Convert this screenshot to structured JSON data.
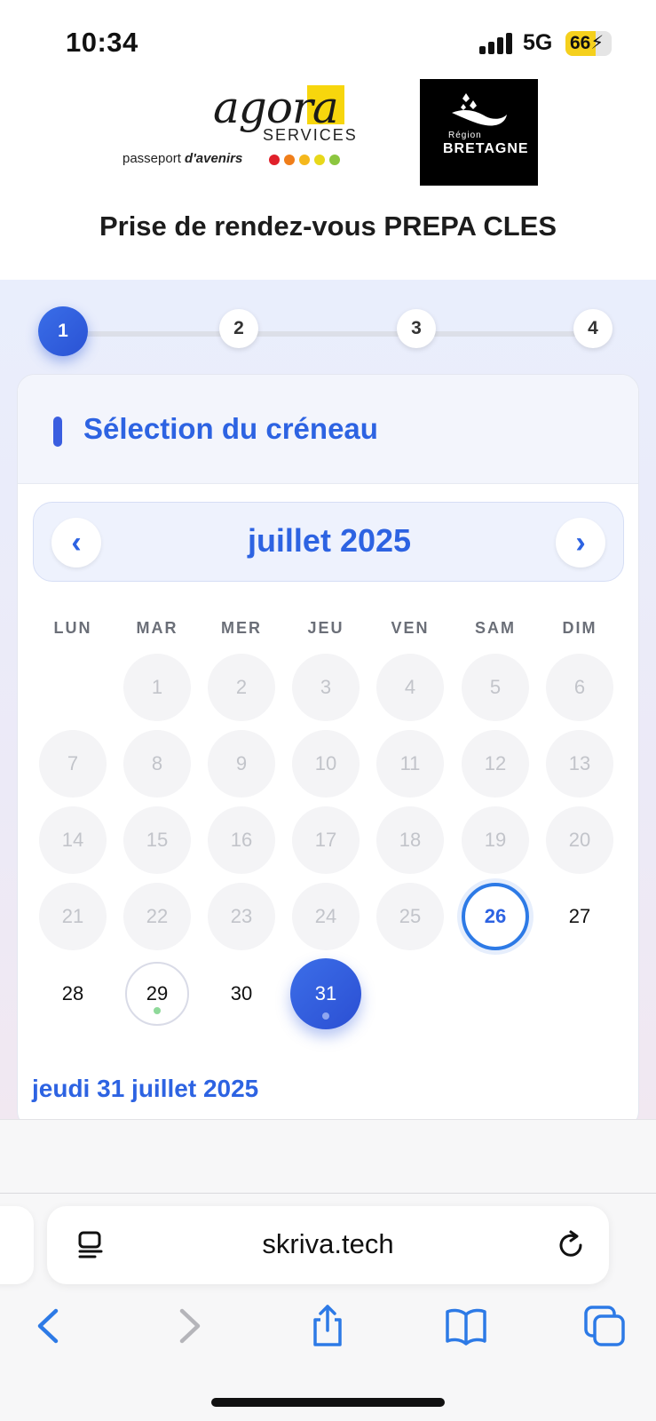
{
  "status_bar": {
    "time": "10:34",
    "network": "5G",
    "battery": "66",
    "battery_level": 0.66
  },
  "header": {
    "agora_logo": {
      "word": "agora",
      "services": "SERVICES",
      "tagline_prefix": "passeport ",
      "tagline_emphasis": "d'avenirs",
      "dot_colors": [
        "#e0202a",
        "#f07e1a",
        "#f5b81c",
        "#e8d81a",
        "#8cc63f"
      ]
    },
    "region_logo": {
      "region": "Région",
      "name": "BRETAGNE"
    },
    "page_title": "Prise de rendez-vous PREPA CLES"
  },
  "stepper": {
    "steps": [
      "1",
      "2",
      "3",
      "4"
    ],
    "active_step": 1
  },
  "card": {
    "title": "Sélection du créneau",
    "month_label": "juillet 2025",
    "prev_label": "‹",
    "next_label": "›",
    "weekdays": [
      "LUN",
      "MAR",
      "MER",
      "JEU",
      "VEN",
      "SAM",
      "DIM"
    ],
    "days": [
      {
        "n": "1",
        "state": "disabled"
      },
      {
        "n": "2",
        "state": "disabled"
      },
      {
        "n": "3",
        "state": "disabled"
      },
      {
        "n": "4",
        "state": "disabled"
      },
      {
        "n": "5",
        "state": "disabled"
      },
      {
        "n": "6",
        "state": "disabled"
      },
      {
        "n": "7",
        "state": "disabled"
      },
      {
        "n": "8",
        "state": "disabled"
      },
      {
        "n": "9",
        "state": "disabled"
      },
      {
        "n": "10",
        "state": "disabled"
      },
      {
        "n": "11",
        "state": "disabled"
      },
      {
        "n": "12",
        "state": "disabled"
      },
      {
        "n": "13",
        "state": "disabled"
      },
      {
        "n": "14",
        "state": "disabled"
      },
      {
        "n": "15",
        "state": "disabled"
      },
      {
        "n": "16",
        "state": "disabled"
      },
      {
        "n": "17",
        "state": "disabled"
      },
      {
        "n": "18",
        "state": "disabled"
      },
      {
        "n": "19",
        "state": "disabled"
      },
      {
        "n": "20",
        "state": "disabled"
      },
      {
        "n": "21",
        "state": "disabled"
      },
      {
        "n": "22",
        "state": "disabled"
      },
      {
        "n": "23",
        "state": "disabled"
      },
      {
        "n": "24",
        "state": "disabled"
      },
      {
        "n": "25",
        "state": "disabled"
      },
      {
        "n": "26",
        "state": "today"
      },
      {
        "n": "27",
        "state": "available"
      },
      {
        "n": "28",
        "state": "available"
      },
      {
        "n": "29",
        "state": "has-slot"
      },
      {
        "n": "30",
        "state": "available"
      },
      {
        "n": "31",
        "state": "selected"
      }
    ],
    "first_weekday_offset": 1,
    "selected_date_label": "jeudi 31 juillet 2025"
  },
  "browser": {
    "url": "skriva.tech"
  },
  "colors": {
    "accent": "#2d63e2",
    "slot_dot": "#8fd99a",
    "selected_dot": "#8fa6f0"
  }
}
